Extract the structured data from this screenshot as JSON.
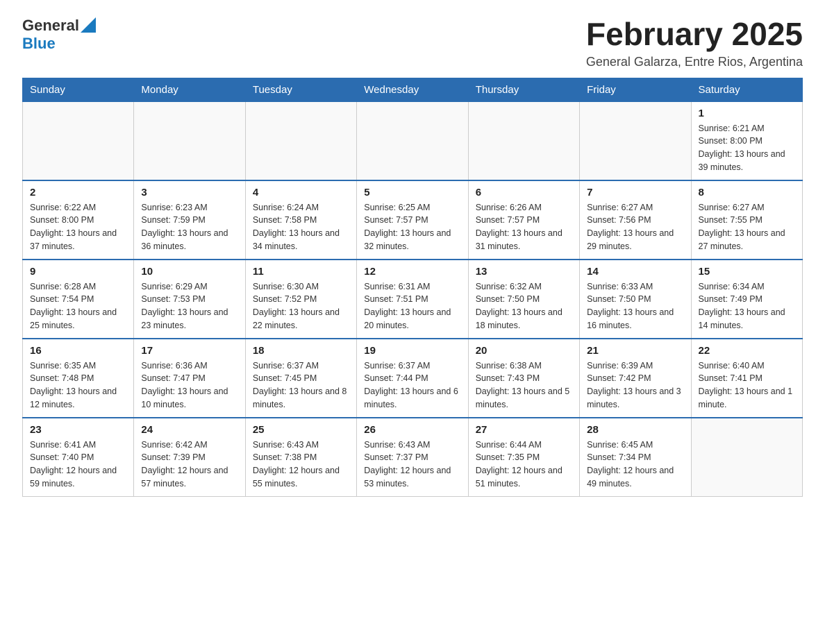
{
  "header": {
    "logo_general": "General",
    "logo_blue": "Blue",
    "month_title": "February 2025",
    "subtitle": "General Galarza, Entre Rios, Argentina"
  },
  "days_of_week": [
    "Sunday",
    "Monday",
    "Tuesday",
    "Wednesday",
    "Thursday",
    "Friday",
    "Saturday"
  ],
  "weeks": [
    [
      {
        "day": "",
        "info": ""
      },
      {
        "day": "",
        "info": ""
      },
      {
        "day": "",
        "info": ""
      },
      {
        "day": "",
        "info": ""
      },
      {
        "day": "",
        "info": ""
      },
      {
        "day": "",
        "info": ""
      },
      {
        "day": "1",
        "info": "Sunrise: 6:21 AM\nSunset: 8:00 PM\nDaylight: 13 hours and 39 minutes."
      }
    ],
    [
      {
        "day": "2",
        "info": "Sunrise: 6:22 AM\nSunset: 8:00 PM\nDaylight: 13 hours and 37 minutes."
      },
      {
        "day": "3",
        "info": "Sunrise: 6:23 AM\nSunset: 7:59 PM\nDaylight: 13 hours and 36 minutes."
      },
      {
        "day": "4",
        "info": "Sunrise: 6:24 AM\nSunset: 7:58 PM\nDaylight: 13 hours and 34 minutes."
      },
      {
        "day": "5",
        "info": "Sunrise: 6:25 AM\nSunset: 7:57 PM\nDaylight: 13 hours and 32 minutes."
      },
      {
        "day": "6",
        "info": "Sunrise: 6:26 AM\nSunset: 7:57 PM\nDaylight: 13 hours and 31 minutes."
      },
      {
        "day": "7",
        "info": "Sunrise: 6:27 AM\nSunset: 7:56 PM\nDaylight: 13 hours and 29 minutes."
      },
      {
        "day": "8",
        "info": "Sunrise: 6:27 AM\nSunset: 7:55 PM\nDaylight: 13 hours and 27 minutes."
      }
    ],
    [
      {
        "day": "9",
        "info": "Sunrise: 6:28 AM\nSunset: 7:54 PM\nDaylight: 13 hours and 25 minutes."
      },
      {
        "day": "10",
        "info": "Sunrise: 6:29 AM\nSunset: 7:53 PM\nDaylight: 13 hours and 23 minutes."
      },
      {
        "day": "11",
        "info": "Sunrise: 6:30 AM\nSunset: 7:52 PM\nDaylight: 13 hours and 22 minutes."
      },
      {
        "day": "12",
        "info": "Sunrise: 6:31 AM\nSunset: 7:51 PM\nDaylight: 13 hours and 20 minutes."
      },
      {
        "day": "13",
        "info": "Sunrise: 6:32 AM\nSunset: 7:50 PM\nDaylight: 13 hours and 18 minutes."
      },
      {
        "day": "14",
        "info": "Sunrise: 6:33 AM\nSunset: 7:50 PM\nDaylight: 13 hours and 16 minutes."
      },
      {
        "day": "15",
        "info": "Sunrise: 6:34 AM\nSunset: 7:49 PM\nDaylight: 13 hours and 14 minutes."
      }
    ],
    [
      {
        "day": "16",
        "info": "Sunrise: 6:35 AM\nSunset: 7:48 PM\nDaylight: 13 hours and 12 minutes."
      },
      {
        "day": "17",
        "info": "Sunrise: 6:36 AM\nSunset: 7:47 PM\nDaylight: 13 hours and 10 minutes."
      },
      {
        "day": "18",
        "info": "Sunrise: 6:37 AM\nSunset: 7:45 PM\nDaylight: 13 hours and 8 minutes."
      },
      {
        "day": "19",
        "info": "Sunrise: 6:37 AM\nSunset: 7:44 PM\nDaylight: 13 hours and 6 minutes."
      },
      {
        "day": "20",
        "info": "Sunrise: 6:38 AM\nSunset: 7:43 PM\nDaylight: 13 hours and 5 minutes."
      },
      {
        "day": "21",
        "info": "Sunrise: 6:39 AM\nSunset: 7:42 PM\nDaylight: 13 hours and 3 minutes."
      },
      {
        "day": "22",
        "info": "Sunrise: 6:40 AM\nSunset: 7:41 PM\nDaylight: 13 hours and 1 minute."
      }
    ],
    [
      {
        "day": "23",
        "info": "Sunrise: 6:41 AM\nSunset: 7:40 PM\nDaylight: 12 hours and 59 minutes."
      },
      {
        "day": "24",
        "info": "Sunrise: 6:42 AM\nSunset: 7:39 PM\nDaylight: 12 hours and 57 minutes."
      },
      {
        "day": "25",
        "info": "Sunrise: 6:43 AM\nSunset: 7:38 PM\nDaylight: 12 hours and 55 minutes."
      },
      {
        "day": "26",
        "info": "Sunrise: 6:43 AM\nSunset: 7:37 PM\nDaylight: 12 hours and 53 minutes."
      },
      {
        "day": "27",
        "info": "Sunrise: 6:44 AM\nSunset: 7:35 PM\nDaylight: 12 hours and 51 minutes."
      },
      {
        "day": "28",
        "info": "Sunrise: 6:45 AM\nSunset: 7:34 PM\nDaylight: 12 hours and 49 minutes."
      },
      {
        "day": "",
        "info": ""
      }
    ]
  ]
}
